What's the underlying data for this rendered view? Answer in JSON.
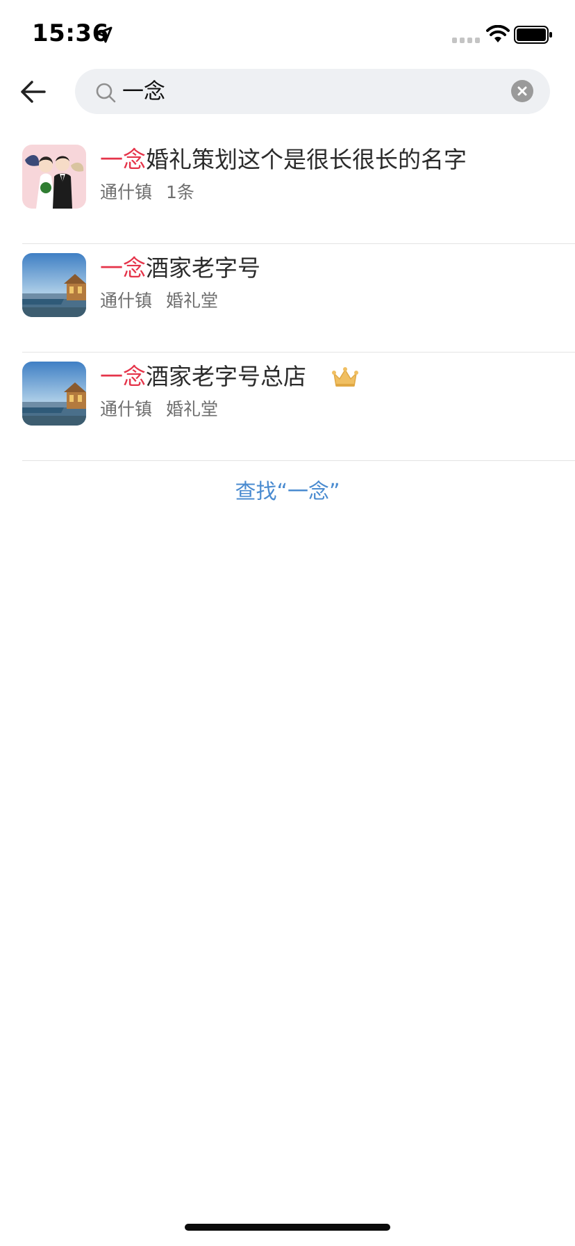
{
  "status": {
    "time": "15:36",
    "icons": [
      "location-arrow-icon",
      "signal-icon",
      "wifi-icon",
      "battery-icon"
    ]
  },
  "search": {
    "query": "一念",
    "back_icon": "back-arrow-icon",
    "search_icon": "search-icon",
    "clear_icon": "clear-icon"
  },
  "results": [
    {
      "title_highlight": "一念",
      "title_rest": "婚礼策划这个是很长很长的名字",
      "meta1": "通什镇",
      "meta2": "1条",
      "thumb": "wedding-couple-cartoon",
      "badge": ""
    },
    {
      "title_highlight": "一念",
      "title_rest": "酒家老字号",
      "meta1": "通什镇",
      "meta2": "婚礼堂",
      "thumb": "resort-pool-photo",
      "badge": ""
    },
    {
      "title_highlight": "一念",
      "title_rest": "酒家老字号总店",
      "meta1": "通什镇",
      "meta2": "婚礼堂",
      "thumb": "resort-pool-photo",
      "badge": "crown-icon"
    }
  ],
  "find_link": "查找“一念”",
  "colors": {
    "highlight": "#e5344a",
    "link": "#4a8bd0",
    "search_bg": "#eef0f3"
  }
}
